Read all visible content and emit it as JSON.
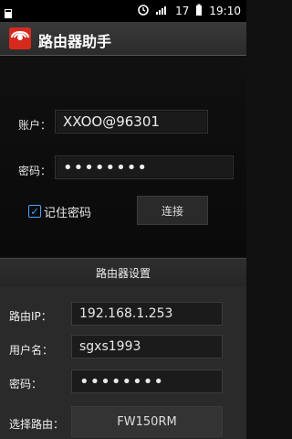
{
  "status": {
    "icons": [
      "notification-icon",
      "alarm-icon",
      "signal-icon"
    ],
    "signal_label": "17",
    "time": "19:10"
  },
  "app": {
    "title": "路由器助手"
  },
  "login": {
    "account_label": "账户：",
    "account_value": "XXOO@96301",
    "password_label": "密码：",
    "password_value": "••••••••",
    "remember_label": "记住密码",
    "remember_checked": true,
    "connect_label": "连接"
  },
  "router_settings": {
    "section_title": "路由器设置",
    "ip_label": "路由IP：",
    "ip_value": "192.168.1.253",
    "username_label": "用户名：",
    "username_value": "sgxs1993",
    "password_label": "密码：",
    "password_value": "••••••••",
    "select_label": "选择路由：",
    "select_value": "FW150RM"
  }
}
